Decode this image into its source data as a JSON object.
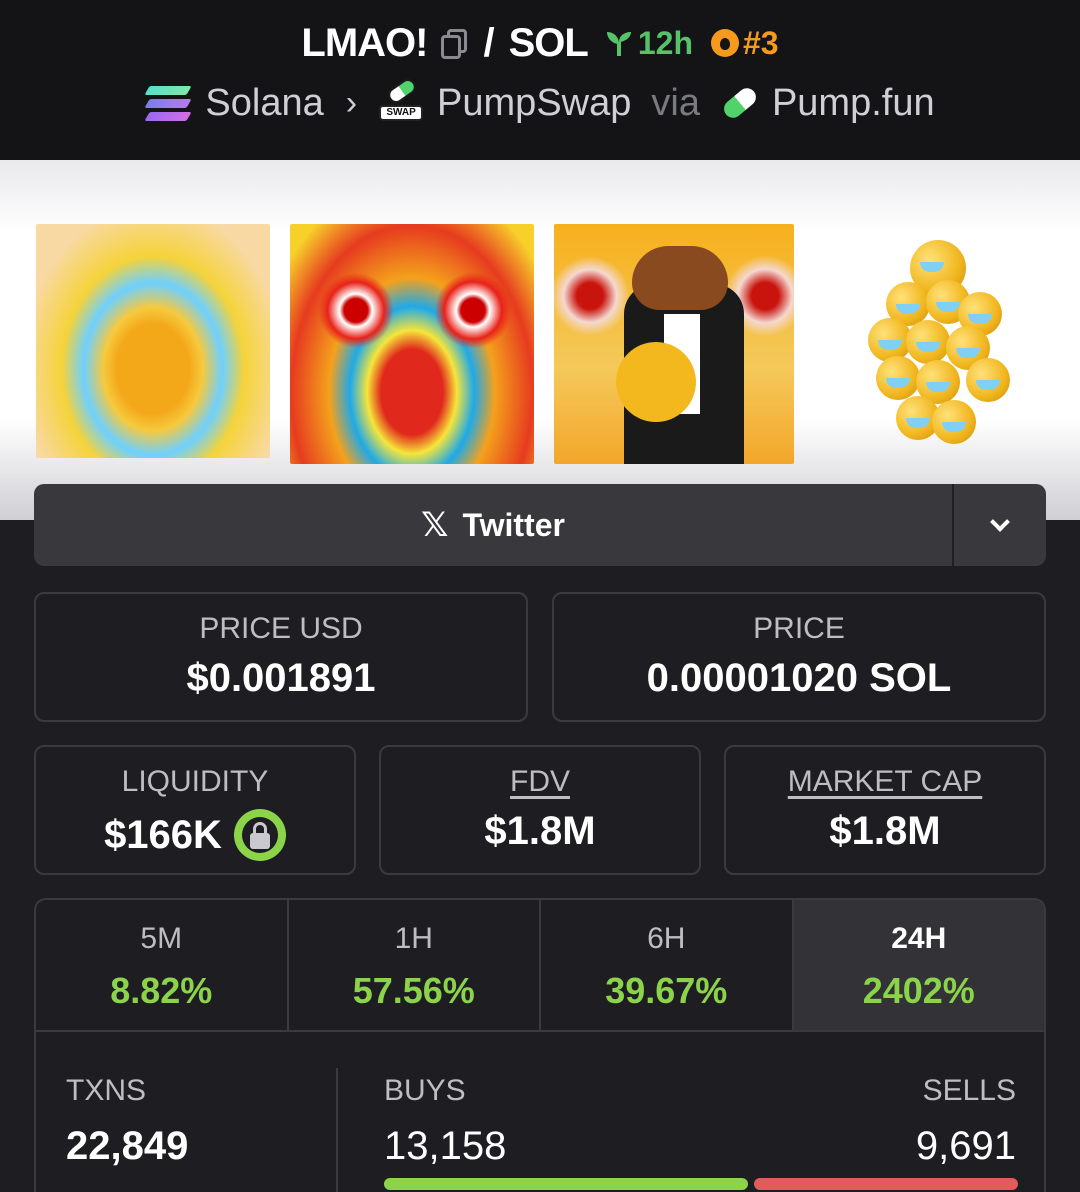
{
  "header": {
    "token": "LMAO!",
    "quote": "SOL",
    "age": "12h",
    "rank": "#3",
    "chain": "Solana",
    "dex": "PumpSwap",
    "dex_badge": "SWAP",
    "via": "via",
    "launchpad": "Pump.fun"
  },
  "social": {
    "label": "Twitter"
  },
  "stats": {
    "price_usd_label": "PRICE USD",
    "price_usd": "$0.001891",
    "price_label": "PRICE",
    "price": "0.00001020 SOL",
    "liquidity_label": "LIQUIDITY",
    "liquidity": "$166K",
    "fdv_label": "FDV",
    "fdv": "$1.8M",
    "mcap_label": "MARKET CAP",
    "mcap": "$1.8M"
  },
  "timeframes": [
    {
      "label": "5M",
      "value": "8.82%"
    },
    {
      "label": "1H",
      "value": "57.56%"
    },
    {
      "label": "6H",
      "value": "39.67%"
    },
    {
      "label": "24H",
      "value": "2402%"
    }
  ],
  "txns": {
    "txns_label": "TXNS",
    "txns": "22,849",
    "buys_label": "BUYS",
    "buys": "13,158",
    "sells_label": "SELLS",
    "sells": "9,691"
  },
  "colors": {
    "positive": "#8bd44a",
    "negative": "#e35b5b",
    "age": "#56c26a",
    "rank": "#f59a1d"
  }
}
